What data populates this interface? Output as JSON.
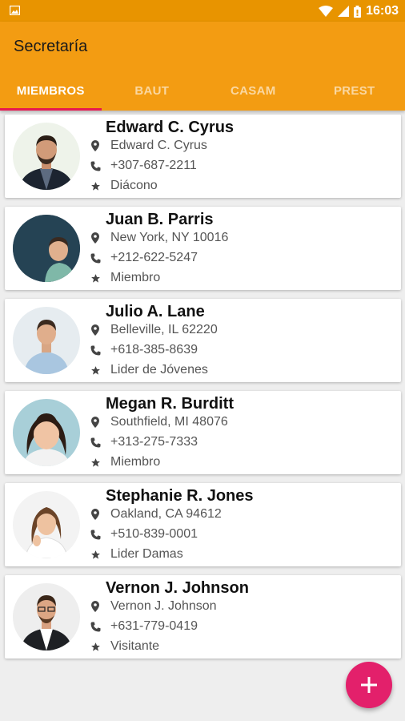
{
  "status_bar": {
    "time": "16:03",
    "icons": [
      "image-icon",
      "wifi-icon",
      "signal-icon",
      "battery-icon"
    ]
  },
  "app_bar": {
    "title": "Secretaría"
  },
  "tabs": [
    {
      "label": "MIEMBROS",
      "active": true
    },
    {
      "label": "BAUT",
      "active": false
    },
    {
      "label": "CASAM",
      "active": false
    },
    {
      "label": "PREST",
      "active": false
    }
  ],
  "members": [
    {
      "name": "Edward C. Cyrus",
      "location": "Edward C. Cyrus",
      "phone": "+307-687-2211",
      "role": "Diácono"
    },
    {
      "name": "Juan B. Parris",
      "location": "New York, NY 10016",
      "phone": "+212-622-5247",
      "role": "Miembro"
    },
    {
      "name": "Julio A. Lane",
      "location": "Belleville, IL 62220",
      "phone": "+618-385-8639",
      "role": "Lider de Jóvenes"
    },
    {
      "name": "Megan R. Burditt",
      "location": "Southfield, MI 48076",
      "phone": "+313-275-7333",
      "role": "Miembro"
    },
    {
      "name": "Stephanie R. Jones",
      "location": "Oakland, CA 94612",
      "phone": "+510-839-0001",
      "role": "Lider Damas"
    },
    {
      "name": "Vernon J. Johnson",
      "location": "Vernon J. Johnson",
      "phone": "+631-779-0419",
      "role": "Visitante"
    }
  ],
  "fab": {
    "icon": "plus-icon"
  },
  "colors": {
    "status_bar": "#e89400",
    "app_bar": "#f39c12",
    "tab_indicator": "#e8184f",
    "fab": "#e3206b"
  }
}
